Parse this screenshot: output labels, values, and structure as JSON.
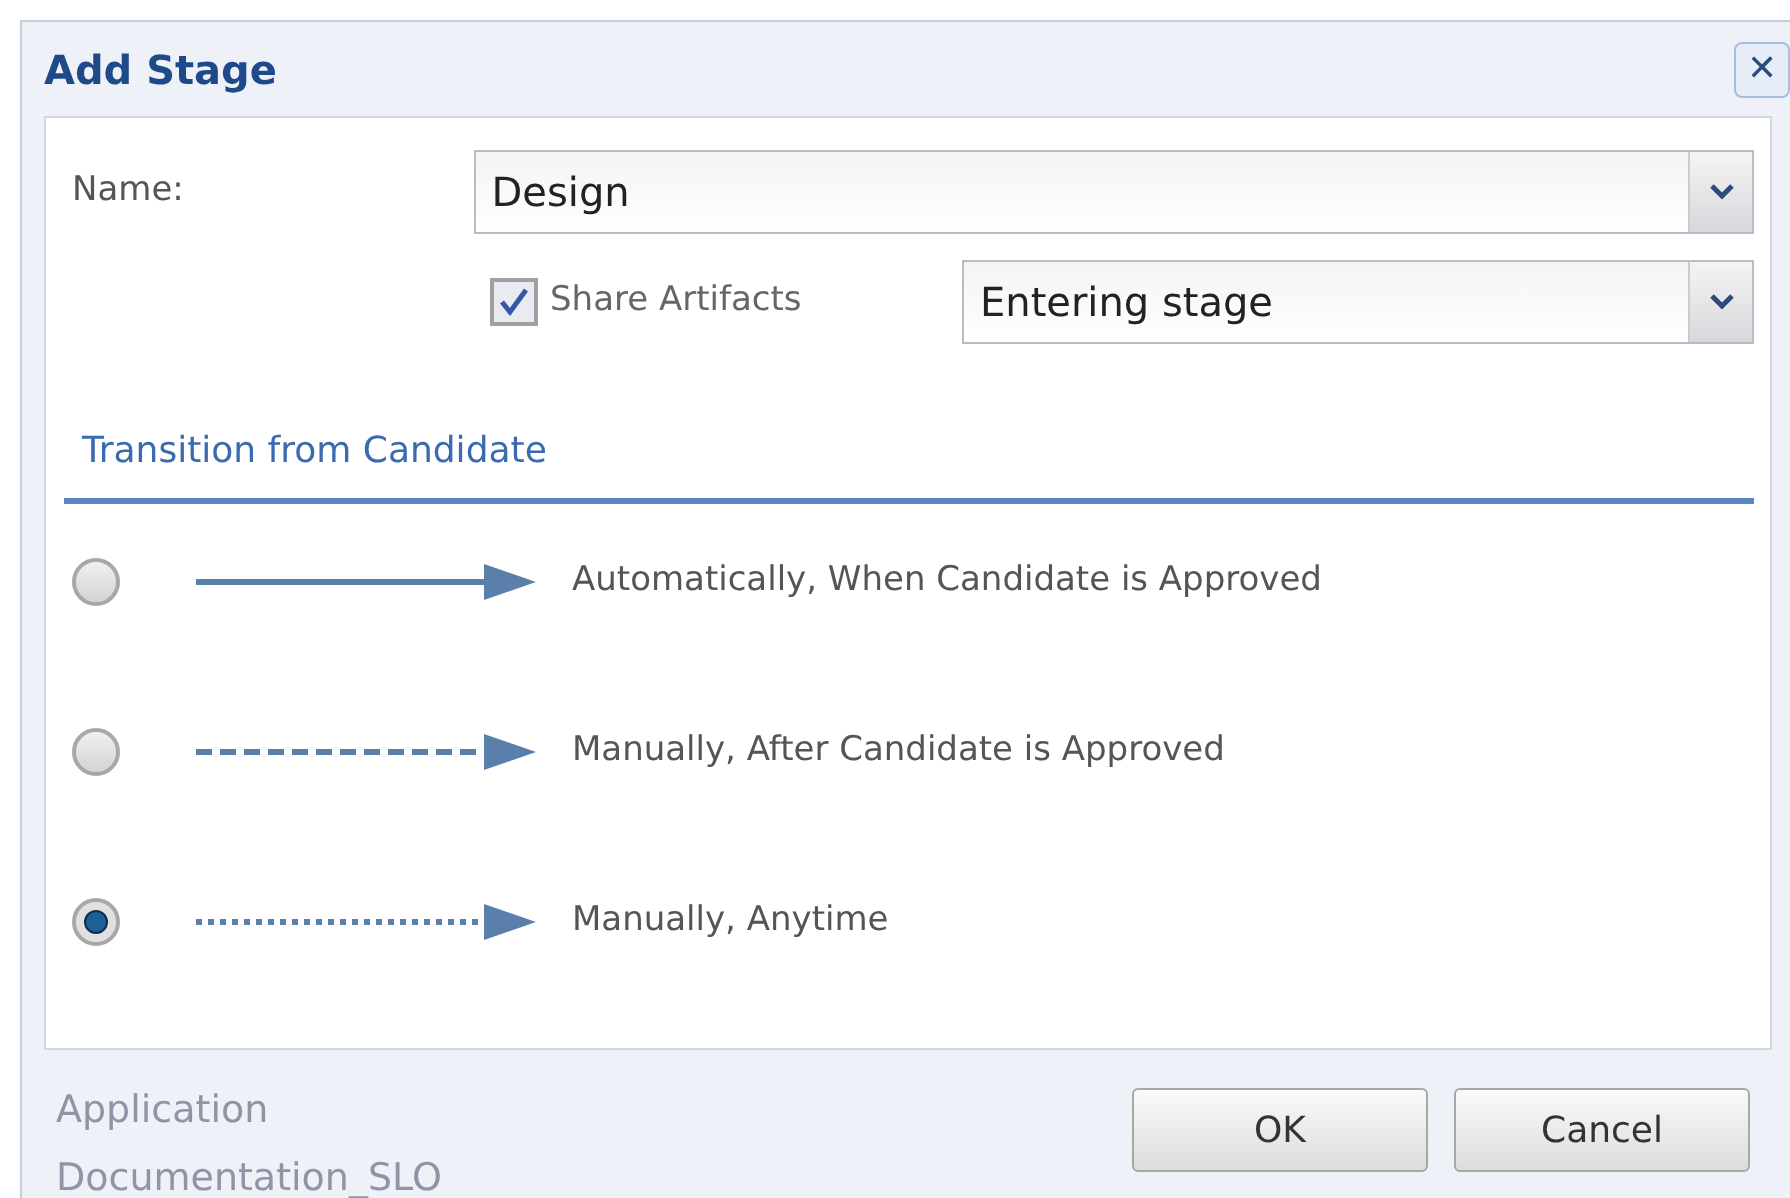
{
  "dialog": {
    "title": "Add Stage",
    "close_glyph": "✕"
  },
  "name_field": {
    "label": "Name:",
    "value": "Design"
  },
  "share_artifacts": {
    "label": "Share Artifacts",
    "checked": true,
    "value": "Entering stage"
  },
  "transition": {
    "heading": "Transition from Candidate",
    "options": [
      {
        "kind": "solid",
        "label": "Automatically, When Candidate is Approved",
        "selected": false
      },
      {
        "kind": "dashed",
        "label": "Manually, After Candidate is Approved",
        "selected": false
      },
      {
        "kind": "dotted",
        "label": "Manually, Anytime",
        "selected": true
      }
    ]
  },
  "background_text": [
    "Application",
    "Documentation_SLO"
  ],
  "buttons": [
    "OK",
    "Cancel"
  ]
}
